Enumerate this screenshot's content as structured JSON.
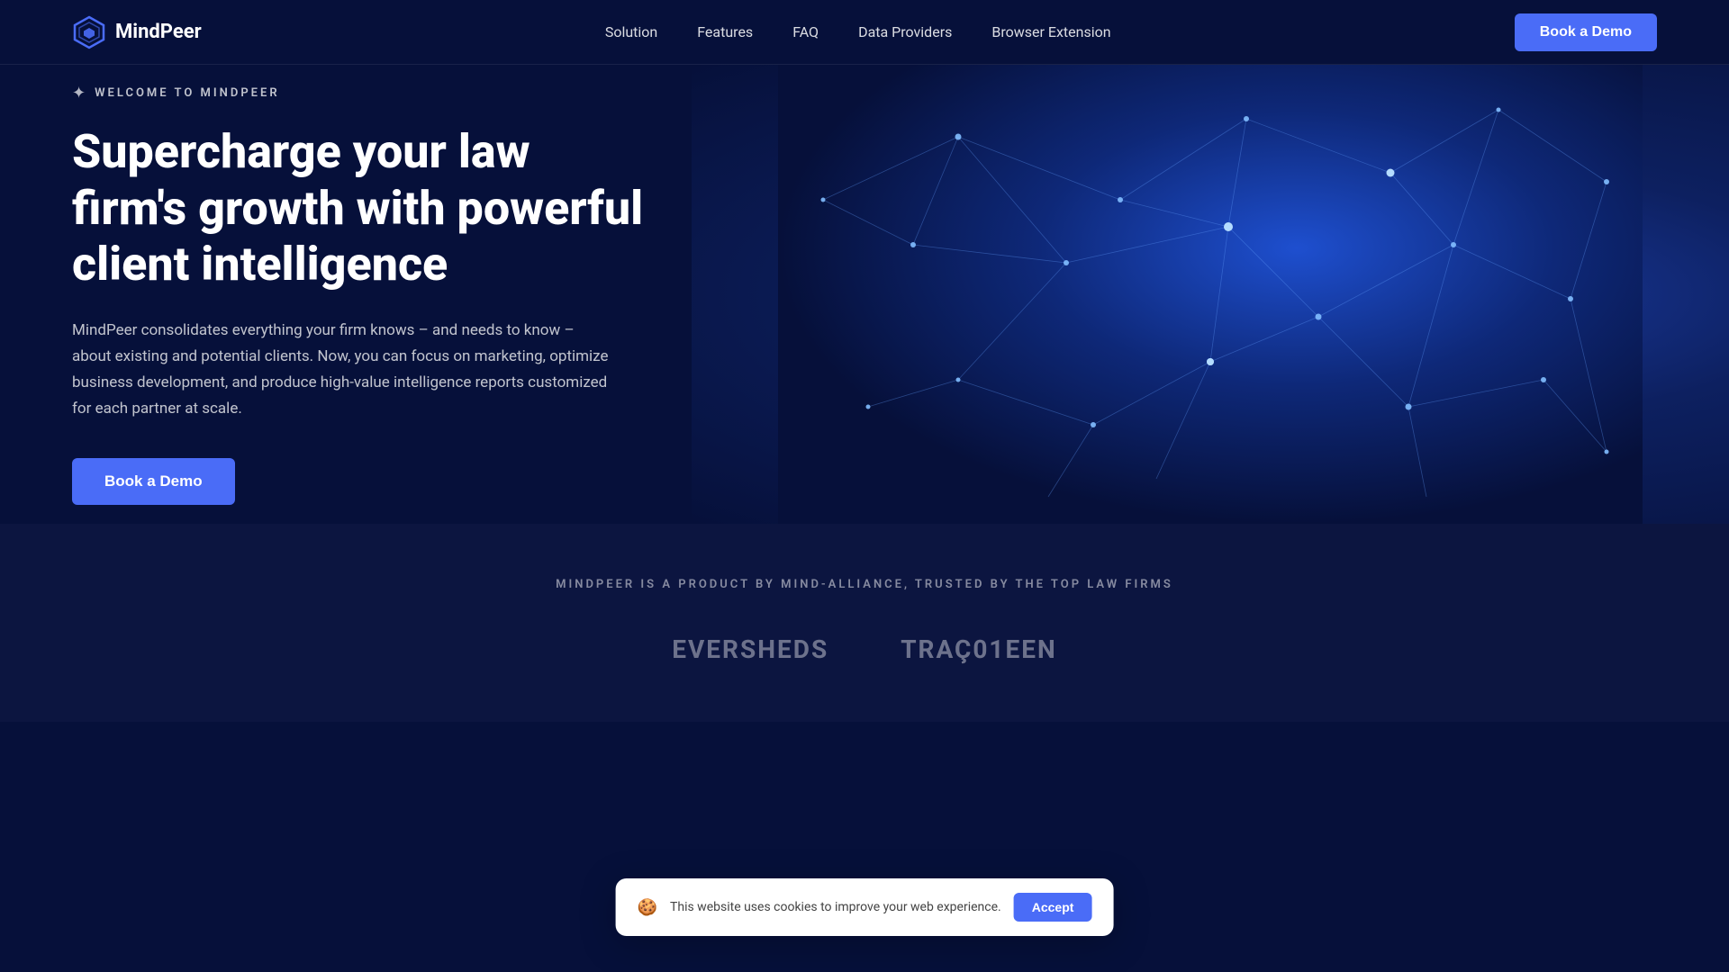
{
  "navbar": {
    "logo_text": "MindPeer",
    "nav_items": [
      {
        "label": "Solution",
        "id": "solution"
      },
      {
        "label": "Features",
        "id": "features"
      },
      {
        "label": "FAQ",
        "id": "faq"
      },
      {
        "label": "Data Providers",
        "id": "data-providers"
      },
      {
        "label": "Browser Extension",
        "id": "browser-extension"
      }
    ],
    "cta_label": "Book a Demo"
  },
  "hero": {
    "eyebrow": "WELCOME TO MINDPEER",
    "title": "Supercharge your law firm's growth with powerful client intelligence",
    "description": "MindPeer consolidates everything your firm knows – and needs to know – about existing and potential clients. Now, you can focus on marketing, optimize business development, and produce high-value intelligence reports customized for each partner at scale.",
    "cta_label": "Book a Demo"
  },
  "trusted": {
    "label": "MINDPEER IS A PRODUCT BY MIND-ALLIANCE, TRUSTED BY THE TOP LAW FIRMS",
    "logos": [
      {
        "text": "EVERSHEDS"
      },
      {
        "text": "TRAÇ01EEN"
      }
    ]
  },
  "cookie": {
    "icon": "🍪",
    "text": "This website uses cookies to improve your web experience.",
    "accept_label": "Accept"
  }
}
